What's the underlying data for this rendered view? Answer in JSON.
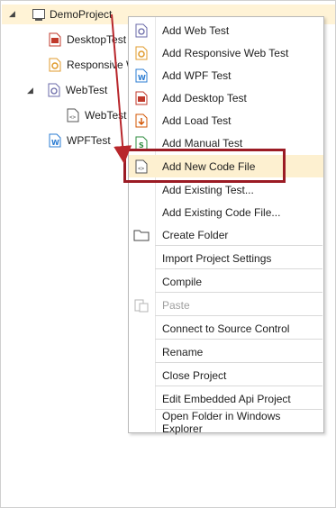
{
  "tree": {
    "root": {
      "label": "DemoProject"
    },
    "items": [
      {
        "label": "DesktopTest",
        "icon": "desktop-test-icon"
      },
      {
        "label": "Responsive W",
        "icon": "responsive-web-test-icon"
      },
      {
        "label": "WebTest",
        "icon": "web-test-icon"
      },
      {
        "label": "WebTest",
        "icon": "code-file-icon"
      },
      {
        "label": "WPFTest",
        "icon": "wpf-test-icon"
      }
    ]
  },
  "menu": {
    "items": [
      {
        "label": "Add Web Test",
        "icon": "web-test-icon"
      },
      {
        "label": "Add Responsive Web Test",
        "icon": "responsive-web-test-icon"
      },
      {
        "label": "Add WPF Test",
        "icon": "wpf-test-icon"
      },
      {
        "label": "Add Desktop Test",
        "icon": "desktop-test-icon"
      },
      {
        "label": "Add Load Test",
        "icon": "load-test-icon"
      },
      {
        "label": "Add Manual Test",
        "icon": "manual-test-icon"
      },
      {
        "label": "Add New Code File",
        "icon": "code-file-icon",
        "highlighted": true
      },
      {
        "label": "Add Existing Test..."
      },
      {
        "label": "Add Existing Code File..."
      },
      {
        "label": "Create Folder",
        "icon": "folder-icon"
      },
      {
        "label": "Import Project Settings"
      },
      {
        "label": "Compile"
      },
      {
        "label": "Paste",
        "icon": "paste-icon",
        "disabled": true
      },
      {
        "label": "Connect to Source Control"
      },
      {
        "label": "Rename"
      },
      {
        "label": "Close Project"
      },
      {
        "label": "Edit Embedded Api Project"
      },
      {
        "label": "Open Folder in Windows Explorer"
      }
    ]
  },
  "colors": {
    "highlight": "#fdf0d0",
    "root_selected": "#fff3d6",
    "callout": "#9b1b24",
    "arrow": "#b8272c"
  }
}
